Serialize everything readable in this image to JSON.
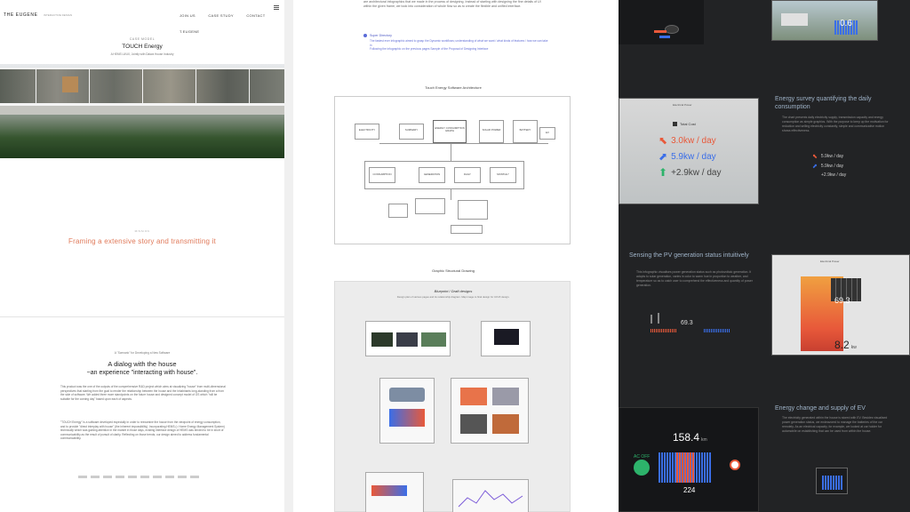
{
  "header": {
    "logo": "THE EUGENE",
    "logo_sub": "INTERACTIVE DESIGN",
    "nav": [
      "JOIN US",
      "CASE STUDY",
      "CONTACT",
      "T.EUGENE"
    ]
  },
  "hero": {
    "kicker": "CASE MODEL",
    "title": "TOUCH Energy",
    "subtitle": "A HEMS UI/UX, Jointly with Daiwa House Industry"
  },
  "mission": {
    "kicker": "MISSION",
    "tagline": "Framing a extensive story and transmitting it"
  },
  "dialog": {
    "kicker": "A \"Scenario\" for Developing a New Software",
    "title": "A dialog with the house",
    "title2": "~an experience \"interacting with house\".",
    "para1": "This product was the one of the outputs of the comprehensive R&D project which aims at visualizing \"house\" from multi-dimensional perspectives that starting from the goal to render the relationship between the house and the inhabitants long-standing from a from the side of software. We added three more standpoints on the future house and designed concept model of OS which \"will be suitable for the coming day\" based upon each of aspects.",
    "para2": "\"TOUCH Energy\" is a software developed especially in order to reexamine the house from the viewpoint of energy consumption, and to provide \"direct interplay with house\" (the inherent impossibility). Incorporating HEMS (= Home Energy Management System) technically which was gaining attention in the market in those days, existing interface design of HEMS was tended to be in short of communicability as the result of pursuit of clarity. Reflecting on those trends, our design aimed to address fundamental communicability."
  },
  "col2": {
    "intro": "are architectural infographics that we made in the process of designing. Instead of starting with designing the fine details of UI within the given frame, we took into consideration of whole flow so as to create the flexible and unified interface.",
    "super_directory": "Super Directory",
    "sd_text1": "The fastest ever infographic aimed to grasp the Dynamic workflows; understanding of what we want / what kinds of features / how we can take in",
    "sd_text2": "Following the infographic on the previous pages Sample of the Proposal of Designing Interface",
    "arch_title": "Touch Energy Software Architecture",
    "struct_title": "Graphic Structural Drawing",
    "blueprint": "Blueprint / Draft designs",
    "blueprint_sub": "Design plan of various pages and its relationship diagram. Map image to final design for UI/UX design.",
    "nodes": [
      "ELECTRICITY",
      "ENERGY CONSUMPTION GRAPH",
      "SOLAR POWER",
      "EV",
      "CONSUMPTION",
      "GENERATION",
      "BATTERY",
      "DAILY",
      "MONTHLY",
      "SUMMARY"
    ]
  },
  "col3": {
    "panel_title": "Electrical Power",
    "total_cost": "Total Cost",
    "value_buy": "3.0kw / day",
    "value_sell": "5.9kw / day",
    "value_net": "+2.9kw / day",
    "small_buy": "5.9kw / day",
    "small_sell": "5.9kw / day",
    "small_net": "+2.9kw / day",
    "heading1": "Energy survey quantifying the daily consumption",
    "text1": "The chart presents daily electricity supply, transmission capacity and energy consumption as simple graphics. With the purpose to keep up the motivation for reduction and selling electricity constantly, simple and communicative motion shows effectiveness.",
    "heading2": "Sensing the PV generation status intuitively",
    "text2": "This infographic visualises power generation status such as photovoltaic generation. It adopts to solar generation, varies in color to warm hue in proportion to weather, and temperature so as to catch user to comprehend the effectiveness and quantity of power generation.",
    "pv_value": "69.3",
    "pv_kw": "8.2",
    "pv_unit": "kw",
    "heading3": "Energy change and supply of EV",
    "text3": "The electricity generated within the house is stored with EV. Besides visualised power generation status, we endeavored to manage the batteries of the car remotely. As an electrical capacity, for example, we looked at car holder for automobile on establishing that can be used from within the house.",
    "ev_range": "158.4",
    "ev_unit": "km",
    "ev_charge": "224",
    "ac_off": "AC OFF",
    "top_value": "0.6"
  },
  "colors": {
    "accent_orange": "#e8593a",
    "accent_blue": "#3a6ee8",
    "accent_green": "#2db36b",
    "dark_bg": "#222325"
  }
}
